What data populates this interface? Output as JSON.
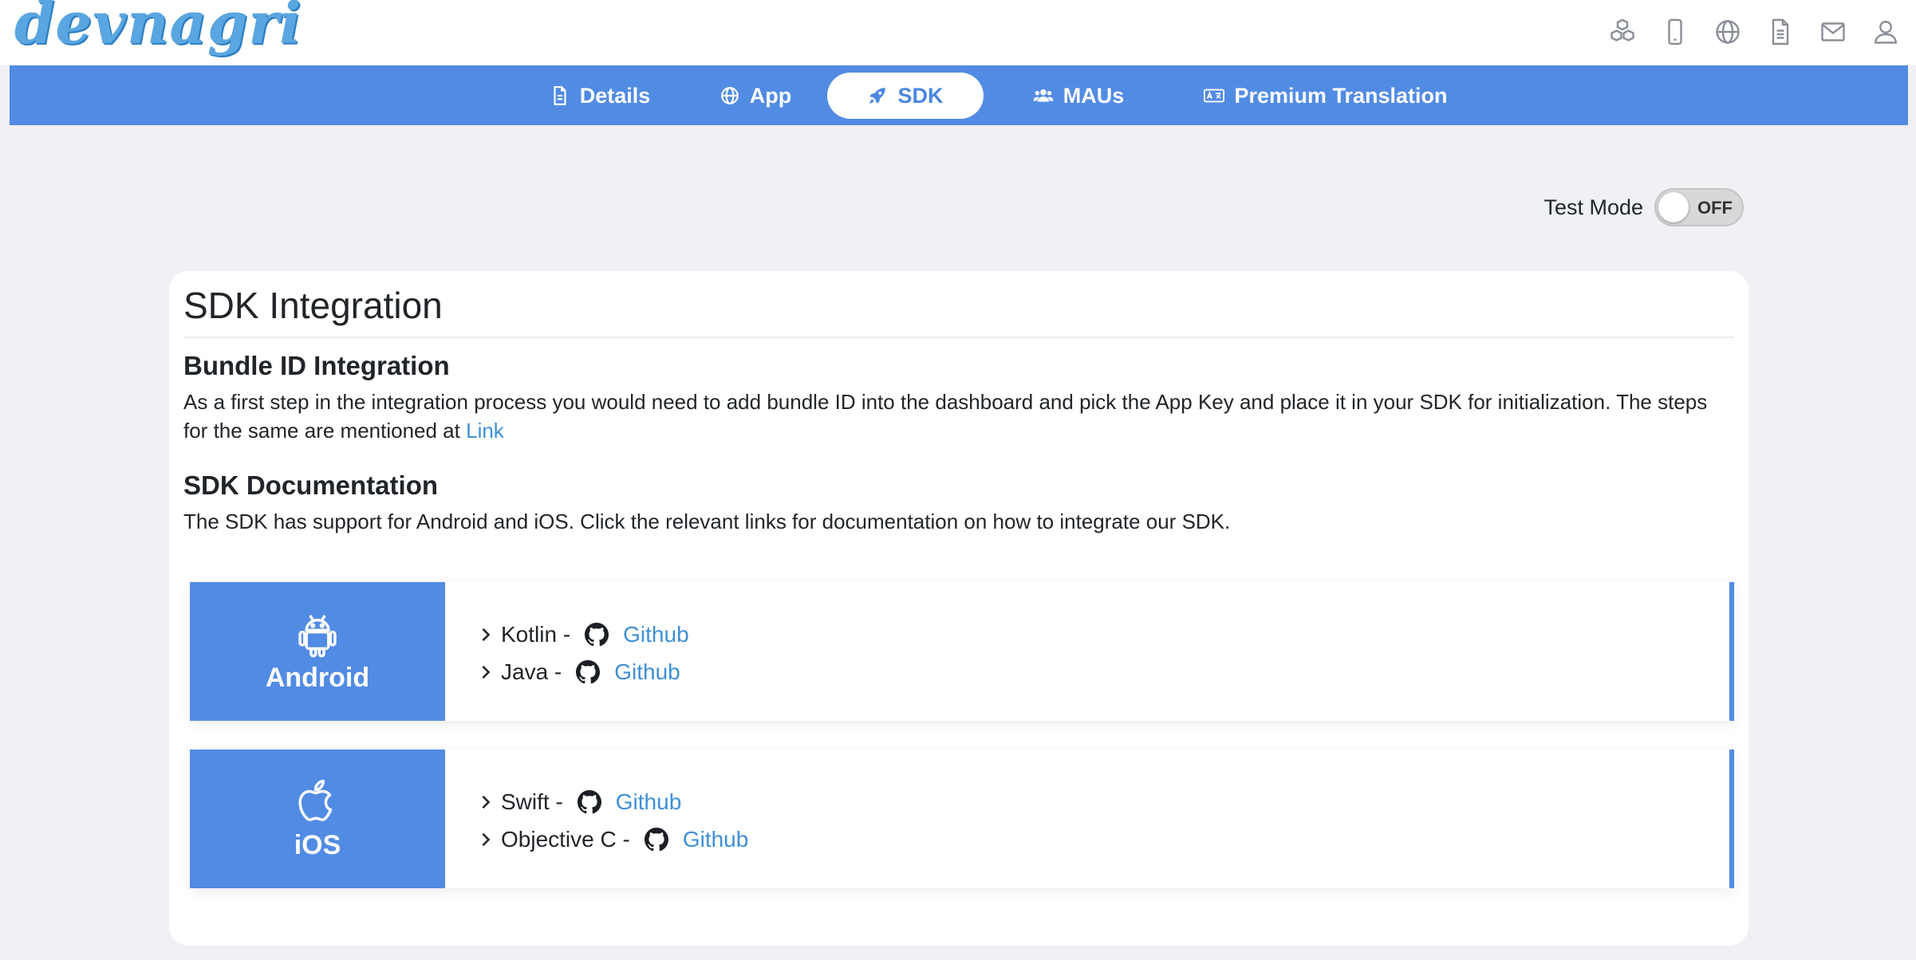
{
  "header": {
    "logo_text": "devnagri",
    "icons": [
      "cubes-icon",
      "mobile-icon",
      "globe-icon",
      "document-icon",
      "mail-icon",
      "user-icon"
    ]
  },
  "nav": {
    "tabs": [
      {
        "label": "Details",
        "icon": "document-icon"
      },
      {
        "label": "App",
        "icon": "globe-icon"
      },
      {
        "label": "SDK",
        "icon": "rocket-icon",
        "active": true
      },
      {
        "label": "MAUs",
        "icon": "users-icon"
      },
      {
        "label": "Premium Translation",
        "icon": "language-icon"
      }
    ]
  },
  "test_mode": {
    "label": "Test Mode",
    "state": "OFF"
  },
  "card": {
    "title": "SDK Integration",
    "bundle": {
      "title": "Bundle ID Integration",
      "text": "As a first step in the integration process you would need to add bundle ID into the dashboard and pick the App Key and place it in your SDK for initialization. The steps for the same are mentioned at",
      "link": "Link"
    },
    "docs": {
      "title": "SDK Documentation",
      "text": "The SDK has support for Android and iOS. Click the relevant links for documentation on how to integrate our SDK."
    },
    "platforms": [
      {
        "name": "Android",
        "icon": "android-icon",
        "items": [
          {
            "label": "Kotlin -",
            "link": "Github"
          },
          {
            "label": "Java -",
            "link": "Github"
          }
        ]
      },
      {
        "name": "iOS",
        "icon": "apple-icon",
        "items": [
          {
            "label": "Swift -",
            "link": "Github"
          },
          {
            "label": "Objective C -",
            "link": "Github"
          }
        ]
      }
    ]
  },
  "colors": {
    "accent": "#528be3",
    "link": "#3f8fd6",
    "background": "#f0f1f4"
  }
}
